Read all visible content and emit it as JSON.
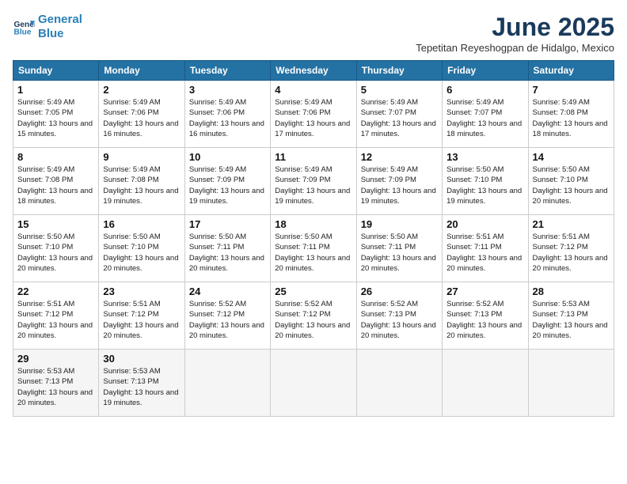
{
  "header": {
    "logo_line1": "General",
    "logo_line2": "Blue",
    "month": "June 2025",
    "location": "Tepetitan Reyeshogpan de Hidalgo, Mexico"
  },
  "days_of_week": [
    "Sunday",
    "Monday",
    "Tuesday",
    "Wednesday",
    "Thursday",
    "Friday",
    "Saturday"
  ],
  "weeks": [
    [
      {
        "day": "1",
        "sunrise": "5:49 AM",
        "sunset": "7:05 PM",
        "daylight": "13 hours and 15 minutes."
      },
      {
        "day": "2",
        "sunrise": "5:49 AM",
        "sunset": "7:06 PM",
        "daylight": "13 hours and 16 minutes."
      },
      {
        "day": "3",
        "sunrise": "5:49 AM",
        "sunset": "7:06 PM",
        "daylight": "13 hours and 16 minutes."
      },
      {
        "day": "4",
        "sunrise": "5:49 AM",
        "sunset": "7:06 PM",
        "daylight": "13 hours and 17 minutes."
      },
      {
        "day": "5",
        "sunrise": "5:49 AM",
        "sunset": "7:07 PM",
        "daylight": "13 hours and 17 minutes."
      },
      {
        "day": "6",
        "sunrise": "5:49 AM",
        "sunset": "7:07 PM",
        "daylight": "13 hours and 18 minutes."
      },
      {
        "day": "7",
        "sunrise": "5:49 AM",
        "sunset": "7:08 PM",
        "daylight": "13 hours and 18 minutes."
      }
    ],
    [
      {
        "day": "8",
        "sunrise": "5:49 AM",
        "sunset": "7:08 PM",
        "daylight": "13 hours and 18 minutes."
      },
      {
        "day": "9",
        "sunrise": "5:49 AM",
        "sunset": "7:08 PM",
        "daylight": "13 hours and 19 minutes."
      },
      {
        "day": "10",
        "sunrise": "5:49 AM",
        "sunset": "7:09 PM",
        "daylight": "13 hours and 19 minutes."
      },
      {
        "day": "11",
        "sunrise": "5:49 AM",
        "sunset": "7:09 PM",
        "daylight": "13 hours and 19 minutes."
      },
      {
        "day": "12",
        "sunrise": "5:49 AM",
        "sunset": "7:09 PM",
        "daylight": "13 hours and 19 minutes."
      },
      {
        "day": "13",
        "sunrise": "5:50 AM",
        "sunset": "7:10 PM",
        "daylight": "13 hours and 19 minutes."
      },
      {
        "day": "14",
        "sunrise": "5:50 AM",
        "sunset": "7:10 PM",
        "daylight": "13 hours and 20 minutes."
      }
    ],
    [
      {
        "day": "15",
        "sunrise": "5:50 AM",
        "sunset": "7:10 PM",
        "daylight": "13 hours and 20 minutes."
      },
      {
        "day": "16",
        "sunrise": "5:50 AM",
        "sunset": "7:10 PM",
        "daylight": "13 hours and 20 minutes."
      },
      {
        "day": "17",
        "sunrise": "5:50 AM",
        "sunset": "7:11 PM",
        "daylight": "13 hours and 20 minutes."
      },
      {
        "day": "18",
        "sunrise": "5:50 AM",
        "sunset": "7:11 PM",
        "daylight": "13 hours and 20 minutes."
      },
      {
        "day": "19",
        "sunrise": "5:50 AM",
        "sunset": "7:11 PM",
        "daylight": "13 hours and 20 minutes."
      },
      {
        "day": "20",
        "sunrise": "5:51 AM",
        "sunset": "7:11 PM",
        "daylight": "13 hours and 20 minutes."
      },
      {
        "day": "21",
        "sunrise": "5:51 AM",
        "sunset": "7:12 PM",
        "daylight": "13 hours and 20 minutes."
      }
    ],
    [
      {
        "day": "22",
        "sunrise": "5:51 AM",
        "sunset": "7:12 PM",
        "daylight": "13 hours and 20 minutes."
      },
      {
        "day": "23",
        "sunrise": "5:51 AM",
        "sunset": "7:12 PM",
        "daylight": "13 hours and 20 minutes."
      },
      {
        "day": "24",
        "sunrise": "5:52 AM",
        "sunset": "7:12 PM",
        "daylight": "13 hours and 20 minutes."
      },
      {
        "day": "25",
        "sunrise": "5:52 AM",
        "sunset": "7:12 PM",
        "daylight": "13 hours and 20 minutes."
      },
      {
        "day": "26",
        "sunrise": "5:52 AM",
        "sunset": "7:13 PM",
        "daylight": "13 hours and 20 minutes."
      },
      {
        "day": "27",
        "sunrise": "5:52 AM",
        "sunset": "7:13 PM",
        "daylight": "13 hours and 20 minutes."
      },
      {
        "day": "28",
        "sunrise": "5:53 AM",
        "sunset": "7:13 PM",
        "daylight": "13 hours and 20 minutes."
      }
    ],
    [
      {
        "day": "29",
        "sunrise": "5:53 AM",
        "sunset": "7:13 PM",
        "daylight": "13 hours and 20 minutes."
      },
      {
        "day": "30",
        "sunrise": "5:53 AM",
        "sunset": "7:13 PM",
        "daylight": "13 hours and 19 minutes."
      },
      null,
      null,
      null,
      null,
      null
    ]
  ]
}
